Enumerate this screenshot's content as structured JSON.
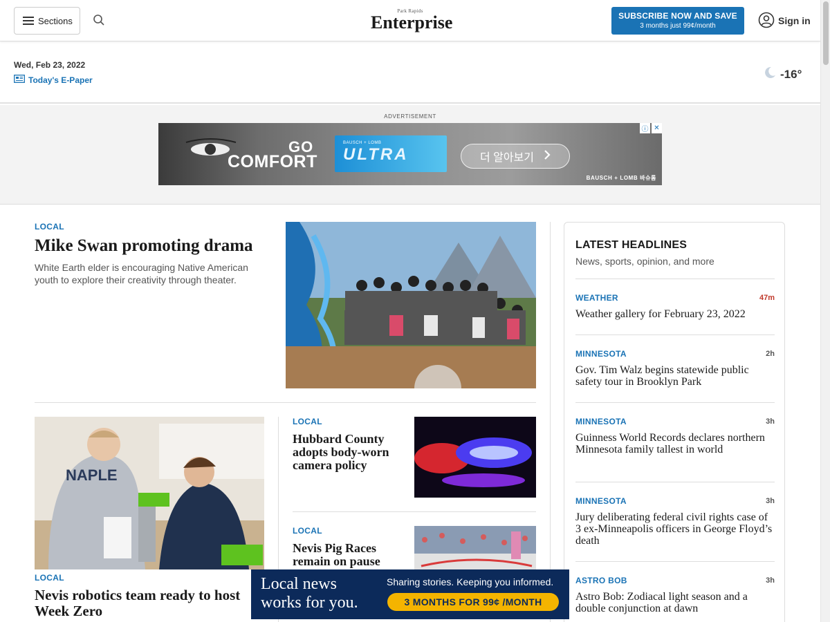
{
  "header": {
    "sections_label": "Sections",
    "logo_small": "Park Rapids",
    "logo_main": "Enterprise",
    "subscribe_main": "SUBSCRIBE NOW AND SAVE",
    "subscribe_sub": "3 months just 99¢/month",
    "signin_label": "Sign in"
  },
  "daterow": {
    "date": "Wed, Feb 23, 2022",
    "epaper_label": "Today's E-Paper",
    "temperature": "-16°"
  },
  "ad_top": {
    "label": "ADVERTISEMENT",
    "go": "GO",
    "comfort": "COMFORT",
    "product_small": "BAUSCH + LOMB",
    "product_big": "ULTRA",
    "cta": "더 알아보기",
    "brand": "BAUSCH + LOMB 바슈롬"
  },
  "lead": {
    "kicker": "LOCAL",
    "headline": "Mike Swan promoting drama",
    "dek": "White Earth elder is encouraging Native American youth to explore their creativity through theater."
  },
  "story_robotics": {
    "kicker": "LOCAL",
    "headline": "Nevis robotics team ready to host Week Zero"
  },
  "story_hubbard": {
    "kicker": "LOCAL",
    "headline": "Hubbard County adopts body-worn camera policy"
  },
  "story_pig": {
    "kicker": "LOCAL",
    "headline": "Nevis Pig Races remain on pause"
  },
  "sidebar": {
    "title": "LATEST HEADLINES",
    "subtitle": "News, sports, opinion, and more",
    "items": [
      {
        "kicker": "WEATHER",
        "time": "47m",
        "headline": "Weather gallery for February 23, 2022"
      },
      {
        "kicker": "MINNESOTA",
        "time": "2h",
        "headline": "Gov. Tim Walz begins statewide public safety tour in Brooklyn Park"
      },
      {
        "kicker": "MINNESOTA",
        "time": "3h",
        "headline": "Guinness World Records declares northern Minnesota family tallest in world"
      },
      {
        "kicker": "MINNESOTA",
        "time": "3h",
        "headline": "Jury deliberating federal civil rights case of 3 ex-Minneapolis officers in George Floyd’s death"
      },
      {
        "kicker": "ASTRO BOB",
        "time": "3h",
        "headline": "Astro Bob: Zodiacal light season and a double conjunction at dawn"
      }
    ]
  },
  "bottom_ad": {
    "left_line1": "Local news",
    "left_line2": "works for you.",
    "right_text": "Sharing stories. Keeping you informed.",
    "button": "3 MONTHS FOR 99¢ /MONTH"
  },
  "colors": {
    "accent": "#1a73b5",
    "recent_time": "#c0392b",
    "bottom_ad_bg": "#0c2a5a",
    "bottom_ad_button": "#f4b400"
  },
  "icons": [
    "hamburger-icon",
    "search-icon",
    "user-circle-icon",
    "newspaper-icon",
    "moon-cloud-icon",
    "chevron-right-icon",
    "ad-info-icon",
    "ad-close-icon"
  ]
}
